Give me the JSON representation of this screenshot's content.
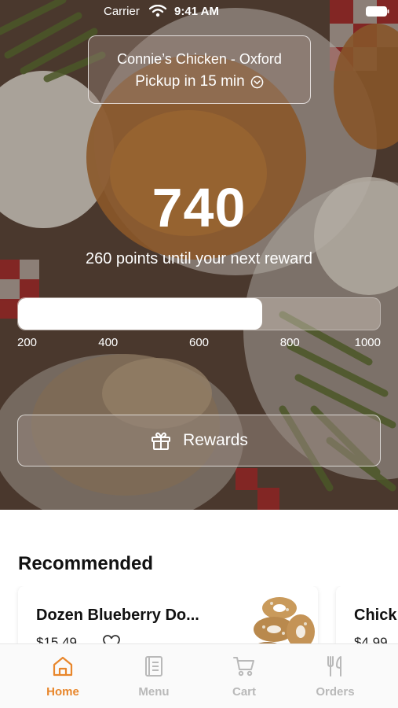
{
  "status_bar": {
    "carrier": "Carrier",
    "time": "9:41 AM"
  },
  "location": {
    "store_name": "Connie’s Chicken - Oxford",
    "pickup_text": "Pickup in 15 min"
  },
  "rewards": {
    "points": "740",
    "subtitle": "260 points until your next reward",
    "progress": {
      "value": 740,
      "min": 200,
      "max": 1000
    },
    "ticks": [
      "200",
      "400",
      "600",
      "800",
      "1000"
    ],
    "button_label": "Rewards"
  },
  "recommended": {
    "title": "Recommended",
    "items": [
      {
        "name": "Dozen Blueberry Do...",
        "price": "$15.49"
      },
      {
        "name": "Chick",
        "price": "$4.99"
      }
    ]
  },
  "tabs": [
    {
      "label": "Home",
      "icon": "home-icon",
      "active": true
    },
    {
      "label": "Menu",
      "icon": "menu-book-icon",
      "active": false
    },
    {
      "label": "Cart",
      "icon": "cart-icon",
      "active": false
    },
    {
      "label": "Orders",
      "icon": "fork-knife-icon",
      "active": false
    }
  ],
  "colors": {
    "accent": "#e8862b",
    "inactive_tab": "#b9b9b9"
  }
}
